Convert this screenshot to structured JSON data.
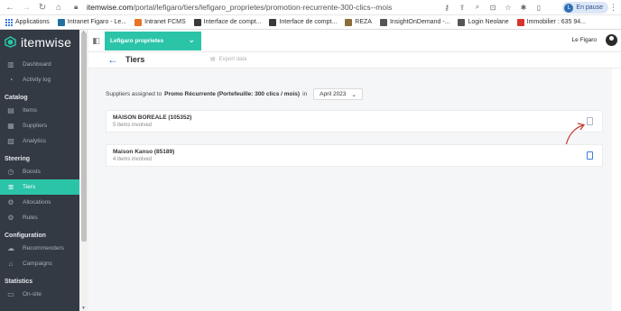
{
  "browser": {
    "url_host": "itemwise.com",
    "url_path": "/portal/lefigaro/tiers/lefigaro_proprietes/promotion-recurrente-300-clics--mois",
    "profile_label": "En pause",
    "profile_initial": "L"
  },
  "bookmarks": [
    {
      "label": "Applications",
      "color": "#3c78d8"
    },
    {
      "label": "Intranet Figaro - Le...",
      "color": "#1f6f9f"
    },
    {
      "label": "Intranet FCMS",
      "color": "#e8742a"
    },
    {
      "label": "Interface de compt...",
      "color": "#3a3a3a"
    },
    {
      "label": "Interface de compt...",
      "color": "#3a3a3a"
    },
    {
      "label": "REZA",
      "color": "#8a6d3b"
    },
    {
      "label": "InsightOnDemand -...",
      "color": "#555555"
    },
    {
      "label": "Login Neolane",
      "color": "#555555"
    },
    {
      "label": "Immobilier : 635 94...",
      "color": "#d9342b"
    }
  ],
  "sidebar": {
    "brand": "itemwise",
    "sections": [
      {
        "title": "",
        "items": [
          {
            "label": "Dashboard",
            "icon": "dashboard-icon",
            "glyph": "▥"
          },
          {
            "label": "Activity log",
            "icon": "activity-icon",
            "glyph": "◔"
          }
        ]
      },
      {
        "title": "Catalog",
        "items": [
          {
            "label": "Items",
            "icon": "items-icon",
            "glyph": "▤"
          },
          {
            "label": "Suppliers",
            "icon": "suppliers-icon",
            "glyph": "▦"
          },
          {
            "label": "Analytics",
            "icon": "analytics-icon",
            "glyph": "▨"
          }
        ]
      },
      {
        "title": "Steering",
        "items": [
          {
            "label": "Boosts",
            "icon": "boost-icon",
            "glyph": "◷"
          },
          {
            "label": "Tiers",
            "icon": "tiers-icon",
            "glyph": "≣",
            "active": true
          },
          {
            "label": "Allocations",
            "icon": "allocations-icon",
            "glyph": "⚙"
          },
          {
            "label": "Rules",
            "icon": "rules-icon",
            "glyph": "⚙"
          }
        ]
      },
      {
        "title": "Configuration",
        "items": [
          {
            "label": "Recommenders",
            "icon": "recommenders-icon",
            "glyph": "☁"
          },
          {
            "label": "Campaigns",
            "icon": "campaigns-icon",
            "glyph": "⌂"
          }
        ]
      },
      {
        "title": "Statistics",
        "items": [
          {
            "label": "On-site",
            "icon": "onsite-icon",
            "glyph": "▭"
          }
        ]
      }
    ]
  },
  "topbar": {
    "site_selector": "Lefigaro proprietes",
    "user": "Le Figaro"
  },
  "page": {
    "title": "Tiers",
    "export_label": "Export data"
  },
  "filter": {
    "prefix": "Suppliers assigned to",
    "tier": "Promo Récurrente (Portefeuille: 300 clics / mois)",
    "in_label": "in",
    "month": "April 2023"
  },
  "suppliers": [
    {
      "name": "MAISON BOREALE (105352)",
      "involved": "5 items involved"
    },
    {
      "name": "Maison Kanso (85189)",
      "involved": "4 items involved"
    }
  ],
  "colors": {
    "accent": "#2bc4a8",
    "sidebar_bg": "#333a44",
    "link": "#2b6fd6",
    "annotation": "#c0392b"
  }
}
